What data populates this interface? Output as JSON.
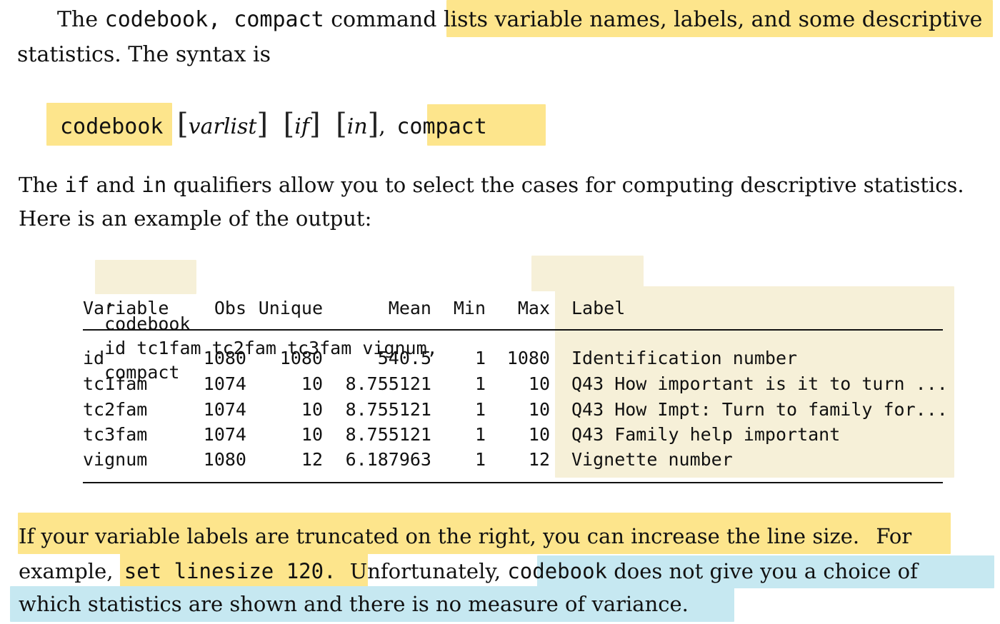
{
  "intro": {
    "prefix": "The",
    "cmd": "codebook, compact",
    "mid": "command",
    "highlighted": "lists variable names, labels, and some descriptive",
    "line2": "statistics. The syntax is"
  },
  "syntax": {
    "cmd": "codebook",
    "varlist": "varlist",
    "if": "if",
    "in": "in",
    "comma": ",",
    "option": "compact",
    "bracket_open": "[",
    "bracket_close": "]"
  },
  "para2": {
    "w1": "The",
    "if": "if",
    "w2": "and",
    "in": "in",
    "w3": "qualifiers allow you to select the cases for computing descriptive statistics.",
    "line2": "Here is an example of the output:"
  },
  "example": {
    "dot": ".",
    "cmd": "codebook",
    "args": "id tc1fam tc2fam tc3fam vignum,",
    "option": "compact",
    "headers": {
      "variable": "Variable",
      "obs": "Obs",
      "unique": "Unique",
      "mean": "Mean",
      "min": "Min",
      "max": "Max",
      "label": "Label"
    },
    "rows": [
      {
        "variable": "id",
        "obs": "1080",
        "unique": "1080",
        "mean": "540.5",
        "min": "1",
        "max": "1080",
        "label": "Identification number"
      },
      {
        "variable": "tc1fam",
        "obs": "1074",
        "unique": "10",
        "mean": "8.755121",
        "min": "1",
        "max": "10",
        "label": "Q43 How important is it to turn ..."
      },
      {
        "variable": "tc2fam",
        "obs": "1074",
        "unique": "10",
        "mean": "8.755121",
        "min": "1",
        "max": "10",
        "label": "Q43 How Impt: Turn to family for..."
      },
      {
        "variable": "tc3fam",
        "obs": "1074",
        "unique": "10",
        "mean": "8.755121",
        "min": "1",
        "max": "10",
        "label": "Q43 Family help important"
      },
      {
        "variable": "vignum",
        "obs": "1080",
        "unique": "12",
        "mean": "6.187963",
        "min": "1",
        "max": "12",
        "label": "Vignette number"
      }
    ]
  },
  "para3": {
    "line1": "If your variable labels are truncated on the right, you can increase the line size.",
    "for": "For",
    "example": "example,",
    "cmd": "set linesize 120.",
    "unfortunately": "Unfortunately,",
    "cmd2": "codebook",
    "blue_rest": "does not give you a choice of",
    "line3": "which statistics are shown and there is no measure of variance."
  },
  "colors": {
    "highlight_yellow": "#fde58c",
    "highlight_pale": "#f6f0d8",
    "highlight_blue": "#c6e8f1"
  }
}
